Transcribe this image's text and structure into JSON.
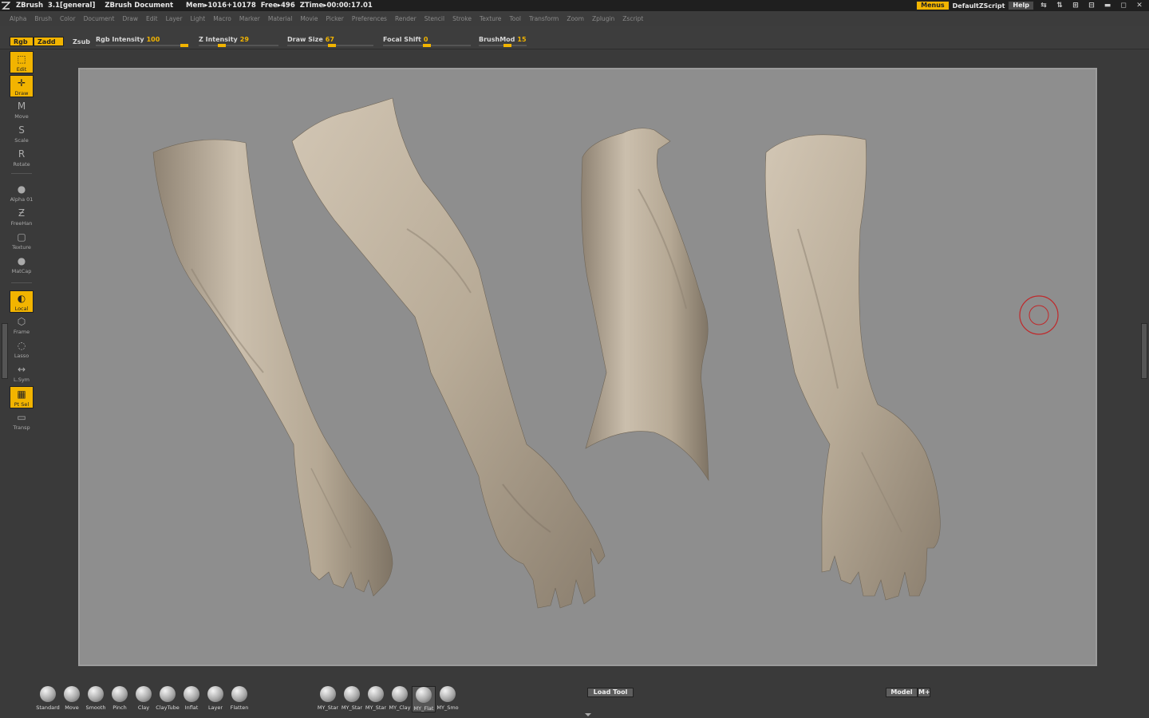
{
  "titlebar": {
    "app": "ZBrush",
    "version": "3.1[general]",
    "document": "ZBrush Document",
    "mem": "Mem▸1016+10178",
    "free": "Free▸496",
    "ztime": "ZTime▸00:00:17.01",
    "menus_btn": "Menus",
    "script": "DefaultZScript",
    "help": "Help"
  },
  "menubar": [
    "Alpha",
    "Brush",
    "Color",
    "Document",
    "Draw",
    "Edit",
    "Layer",
    "Light",
    "Macro",
    "Marker",
    "Material",
    "Movie",
    "Picker",
    "Preferences",
    "Render",
    "Stencil",
    "Stroke",
    "Texture",
    "Tool",
    "Transform",
    "Zoom",
    "Zplugin",
    "Zscript"
  ],
  "topshelf": {
    "rgb": "Rgb",
    "zadd": "Zadd",
    "zsub": "Zsub",
    "rgb_intensity": {
      "label": "Rgb Intensity",
      "value": "100",
      "fraction": 1.0
    },
    "z_intensity": {
      "label": "Z Intensity",
      "value": "29",
      "fraction": 0.29
    },
    "draw_size": {
      "label": "Draw Size",
      "value": "67",
      "fraction": 0.52
    },
    "focal_shift": {
      "label": "Focal Shift",
      "value": "0",
      "fraction": 0.5
    },
    "brushmod": {
      "label": "BrushMod",
      "value": "15",
      "fraction": 0.6
    }
  },
  "lefttools": [
    {
      "label": "Edit",
      "icon": "edit-icon"
    },
    {
      "label": "Draw",
      "icon": "draw-icon"
    },
    {
      "label": "Move",
      "icon": "move-icon"
    },
    {
      "label": "Scale",
      "icon": "scale-icon"
    },
    {
      "label": "Rotate",
      "icon": "rotate-icon"
    },
    {
      "label": "Alpha 01",
      "icon": "alpha-icon"
    },
    {
      "label": "FreeHan",
      "icon": "stroke-icon"
    },
    {
      "label": "Texture",
      "icon": "texture-icon"
    },
    {
      "label": "MatCap",
      "icon": "matcap-icon"
    },
    {
      "label": "Local",
      "icon": "local-icon"
    },
    {
      "label": "Frame",
      "icon": "frame-icon"
    },
    {
      "label": "Lasso",
      "icon": "lasso-icon"
    },
    {
      "label": "L.Sym",
      "icon": "lsym-icon"
    },
    {
      "label": "Pt Sel",
      "icon": "ptsel-icon"
    },
    {
      "label": "Transp",
      "icon": "transp-icon"
    }
  ],
  "brushes_left": [
    "Standard",
    "Move",
    "Smooth",
    "Pinch",
    "Clay",
    "ClayTube",
    "Inflat",
    "Layer",
    "Flatten"
  ],
  "brushes_right": [
    "MY_Star",
    "MY_Star",
    "MY_Star",
    "MY_Clay",
    "MY_Flat",
    "MY_Smo"
  ],
  "load_tool": "Load Tool",
  "model": "Model",
  "mplus": "M+",
  "colors": {
    "accent": "#f2b400",
    "canvas": "#8e8e8e",
    "skin": "#c3b6a3"
  }
}
